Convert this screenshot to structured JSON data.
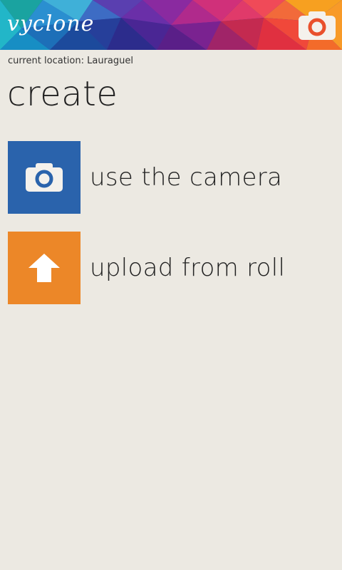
{
  "app": {
    "logo": "vyclone",
    "header_icon": "camera-icon"
  },
  "location": {
    "text": "current location: Lauraguel"
  },
  "page": {
    "title": "create"
  },
  "actions": [
    {
      "label": "use the camera",
      "icon": "camera-icon",
      "color": "#2a63ac"
    },
    {
      "label": "upload from roll",
      "icon": "upload-arrow-icon",
      "color": "#ec8728"
    }
  ],
  "colors": {
    "background": "#ece9e2",
    "camera_tile": "#2a63ac",
    "upload_tile": "#ec8728",
    "header_camera_ring": "#e9502c"
  }
}
